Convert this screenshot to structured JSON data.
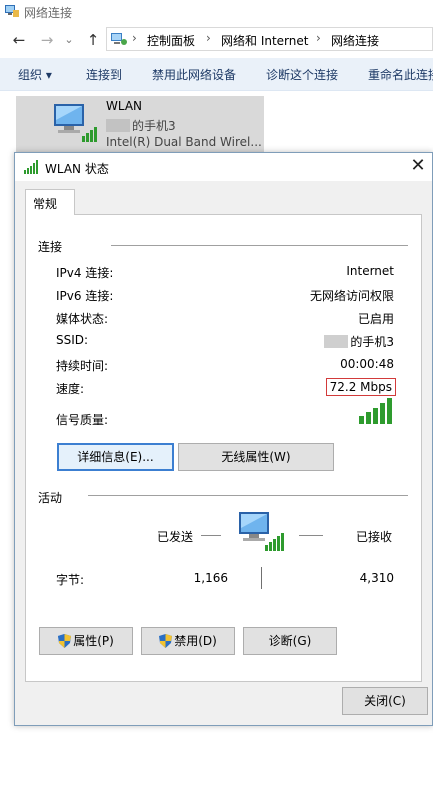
{
  "explorer": {
    "title": "网络连接",
    "breadcrumbs": [
      "控制面板",
      "网络和 Internet",
      "网络连接"
    ],
    "commands": [
      "组织 ▾",
      "连接到",
      "禁用此网络设备",
      "诊断这个连接",
      "重命名此连接"
    ],
    "item": {
      "name": "WLAN",
      "ssid_suffix": "的手机3",
      "adapter": "Intel(R) Dual Band Wirel..."
    }
  },
  "dialog": {
    "title": "WLAN 状态",
    "close_glyph": "✕",
    "tab": "常规",
    "connection": {
      "heading": "连接",
      "rows": [
        {
          "label": "IPv4 连接:",
          "value": "Internet"
        },
        {
          "label": "IPv6 连接:",
          "value": "无网络访问权限"
        },
        {
          "label": "媒体状态:",
          "value": "已启用"
        },
        {
          "label": "SSID:",
          "value": "的手机3"
        },
        {
          "label": "持续时间:",
          "value": "00:00:48"
        },
        {
          "label": "速度:",
          "value": "72.2 Mbps"
        },
        {
          "label": "信号质量:",
          "value": ""
        }
      ],
      "signal_bars": 5
    },
    "buttons": {
      "details": "详细信息(E)...",
      "wireless_props": "无线属性(W)"
    },
    "activity": {
      "heading": "活动",
      "sent_label": "已发送",
      "received_label": "已接收",
      "bytes_label": "字节:",
      "sent_bytes": "1,166",
      "received_bytes": "4,310"
    },
    "bottom_buttons": {
      "properties": "属性(P)",
      "disable": "禁用(D)",
      "diagnose": "诊断(G)"
    },
    "close_button": "关闭(C)"
  },
  "colors": {
    "cmdbar_bg": "#eaf1f9",
    "signal_green": "#2e9b2e",
    "highlight_box": "#d23a3a"
  }
}
